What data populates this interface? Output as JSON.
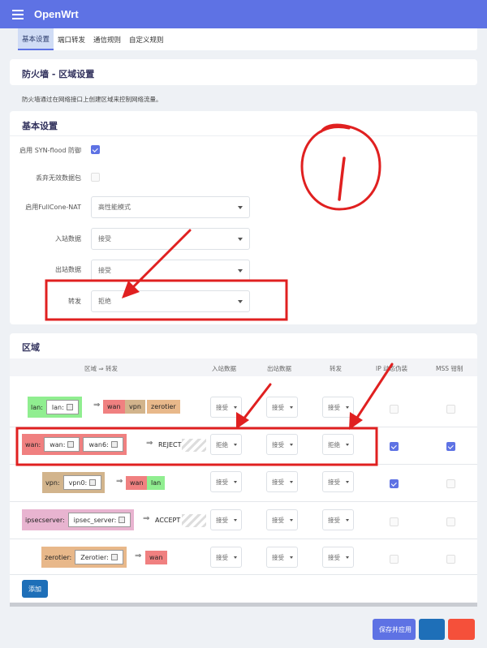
{
  "app": {
    "brand": "OpenWrt"
  },
  "tabs": [
    {
      "label": "基本设置",
      "active": true
    },
    {
      "label": "端口转发",
      "active": false
    },
    {
      "label": "通信规则",
      "active": false
    },
    {
      "label": "自定义规则",
      "active": false
    }
  ],
  "page": {
    "title": "防火墙 - 区域设置",
    "description": "防火墙通过在网络接口上创建区域来控制网络流量。"
  },
  "basic": {
    "title": "基本设置",
    "syn_flood": {
      "label": "启用 SYN-flood 防御",
      "checked": true
    },
    "drop_invalid": {
      "label": "丢弃无效数据包",
      "checked": false
    },
    "fullcone": {
      "label": "启用FullCone-NAT",
      "value": "高性能模式"
    },
    "input": {
      "label": "入站数据",
      "value": "接受"
    },
    "output": {
      "label": "出站数据",
      "value": "接受"
    },
    "forward": {
      "label": "转发",
      "value": "拒绝"
    }
  },
  "zones": {
    "title": "区域",
    "headers": {
      "zone_forward": "区域 ⇒ 转发",
      "input": "入站数据",
      "output": "出站数据",
      "forward": "转发",
      "masq": "IP 动态伪装",
      "mss": "MSS 钳制"
    },
    "arrow": "⇒",
    "rows": [
      {
        "name": "lan",
        "label": "lan:",
        "inputs": [
          "lan:"
        ],
        "targets": [
          "wan",
          "vpn",
          "zerotier"
        ],
        "policy": "",
        "input": "接受",
        "output": "接受",
        "forward": "接受",
        "masq": false,
        "mss": false
      },
      {
        "name": "wan",
        "label": "wan:",
        "inputs": [
          "wan:",
          "wan6:"
        ],
        "targets": [],
        "policy": "REJECT",
        "input": "拒绝",
        "output": "接受",
        "forward": "拒绝",
        "masq": true,
        "mss": true
      },
      {
        "name": "vpn",
        "label": "vpn:",
        "inputs": [
          "vpn0:"
        ],
        "targets": [
          "wan",
          "lan"
        ],
        "policy": "",
        "input": "接受",
        "output": "接受",
        "forward": "接受",
        "masq": true,
        "mss": false
      },
      {
        "name": "ipsecserver",
        "label": "ipsecserver:",
        "inputs": [
          "ipsec_server:"
        ],
        "targets": [],
        "policy": "ACCEPT",
        "input": "接受",
        "output": "接受",
        "forward": "接受",
        "masq": false,
        "mss": false
      },
      {
        "name": "zerotier",
        "label": "zerotier:",
        "inputs": [
          "Zerotier:"
        ],
        "targets": [
          "wan"
        ],
        "policy": "",
        "input": "接受",
        "output": "接受",
        "forward": "接受",
        "masq": false,
        "mss": false
      }
    ],
    "add_button": "添加"
  },
  "footer": {
    "save_apply": "保存并应用"
  },
  "annotation": {
    "circle_text": "1"
  },
  "colors": {
    "accent": "#5e72e4",
    "lan": "#90ee90",
    "wan": "#f08080",
    "vpn": "#d2b48c",
    "ipsecserver": "#e8b4d0",
    "zerotier": "#e8b88a",
    "highlight_red": "#e02020",
    "add_button": "#1e6fb8"
  }
}
